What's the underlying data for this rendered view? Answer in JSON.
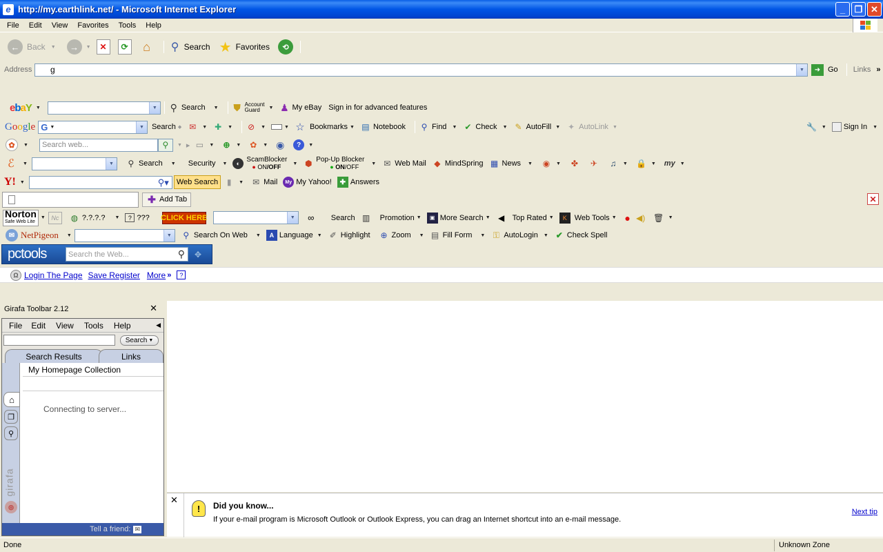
{
  "window": {
    "title": "http://my.earthlink.net/ - Microsoft Internet Explorer"
  },
  "menu": [
    "File",
    "Edit",
    "View",
    "Favorites",
    "Tools",
    "Help"
  ],
  "standard_buttons": {
    "back": "Back",
    "search": "Search",
    "favorites": "Favorites"
  },
  "address": {
    "label": "Address",
    "value": "g",
    "go": "Go",
    "links": "Links"
  },
  "ebay_bar": {
    "search": "Search",
    "account_guard_1": "Account",
    "account_guard_2": "Guard",
    "my_ebay": "My eBay",
    "sign_in_text": "Sign in for advanced features"
  },
  "google_bar": {
    "search": "Search",
    "bookmarks": "Bookmarks",
    "notebook": "Notebook",
    "find": "Find",
    "check": "Check",
    "autofill": "AutoFill",
    "autolink": "AutoLink",
    "sign_in": "Sign In"
  },
  "msn_bar": {
    "placeholder": "Search web..."
  },
  "earthlink_bar": {
    "search": "Search",
    "security": "Security",
    "scamblocker": "ScamBlocker",
    "scam_state_on": "ON",
    "scam_state_off": "/OFF",
    "popup_blocker": "Pop-Up Blocker",
    "popup_state_on": "ON",
    "popup_state_off": "/OFF",
    "web_mail": "Web Mail",
    "mindspring": "MindSpring",
    "news": "News"
  },
  "yahoo_bar": {
    "web_search": "Web Search",
    "mail": "Mail",
    "my_yahoo": "My Yahoo!",
    "answers": "Answers"
  },
  "tab_bar": {
    "add_tab": "Add Tab"
  },
  "norton_bar": {
    "norton": "Norton",
    "safe_web_lite": "Safe Web Lite",
    "rating": "?.?.?.?",
    "q": "???",
    "click_here": "CLICK HERE",
    "search": "Search",
    "promotion": "Promotion",
    "more_search": "More Search",
    "top_rated": "Top Rated",
    "web_tools": "Web Tools"
  },
  "netpigeon_bar": {
    "brand": "NetPigeon",
    "search_on_web": "Search On Web",
    "language": "Language",
    "highlight": "Highlight",
    "zoom": "Zoom",
    "fill_form": "Fill Form",
    "autologin": "AutoLogin",
    "check_spell": "Check Spell"
  },
  "pctools_bar": {
    "brand": "pctools",
    "placeholder": "Search the Web..."
  },
  "login_bar": {
    "login_page": "Login The Page",
    "save_register": "Save Register",
    "more": "More"
  },
  "girafa": {
    "title": "Girafa Toolbar 2.12",
    "menu": [
      "File",
      "Edit",
      "View",
      "Tools",
      "Help"
    ],
    "search_button": "Search",
    "tabs": [
      "Search Results",
      "Links"
    ],
    "collection": "My Homepage Collection",
    "status": "Connecting to server...",
    "tell_friend": "Tell a friend:",
    "brand": "girafa"
  },
  "tip": {
    "title": "Did you know...",
    "text": "If your e-mail program is Microsoft Outlook or Outlook Express, you can drag an Internet shortcut into an e-mail message.",
    "next": "Next tip"
  },
  "status_bar": {
    "left": "Done",
    "zone": "Unknown Zone"
  },
  "colors": {
    "title_bar": "#0054e3",
    "toolbar_bg": "#ece9d8",
    "link": "#0000cc",
    "click_here_bg": "#cc3300"
  }
}
